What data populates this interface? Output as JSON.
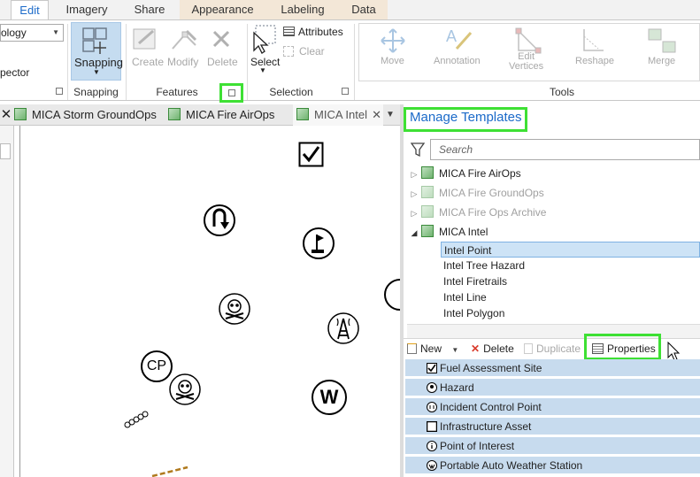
{
  "tabs": [
    {
      "label": "Edit"
    },
    {
      "label": "Imagery"
    },
    {
      "label": "Share"
    },
    {
      "label": "Appearance"
    },
    {
      "label": "Labeling"
    },
    {
      "label": "Data"
    }
  ],
  "ribbon": {
    "combo_value": "ology",
    "inspector_label": "pector",
    "snapping_label": "Snapping",
    "snapping_group": "Snapping",
    "create_label": "Create",
    "modify_label": "Modify",
    "delete_label": "Delete",
    "features_group": "Features",
    "select_label": "Select",
    "attributes_label": "Attributes",
    "clear_label": "Clear",
    "selection_group": "Selection",
    "move_label": "Move",
    "annotation_label": "Annotation",
    "edit_vertices_label": "Edit\nVertices",
    "reshape_label": "Reshape",
    "merge_label": "Merge",
    "tools_group": "Tools"
  },
  "doc_tabs": [
    {
      "label": "MICA Storm GroundOps"
    },
    {
      "label": "MICA Fire AirOps"
    },
    {
      "label": "MICA Intel"
    }
  ],
  "templates": {
    "title": "Manage Templates",
    "search_placeholder": "Search",
    "maps": [
      {
        "label": "MICA Fire AirOps",
        "faded": false
      },
      {
        "label": "MICA Fire GroundOps",
        "faded": true
      },
      {
        "label": "MICA Fire Ops Archive",
        "faded": true
      },
      {
        "label": "MICA Intel",
        "faded": false
      }
    ],
    "layers": [
      "Intel Point",
      "Intel Tree Hazard",
      "Intel Firetrails",
      "Intel Line",
      "Intel Polygon"
    ],
    "toolbar": {
      "new_label": "New",
      "delete_label": "Delete",
      "duplicate_label": "Duplicate",
      "properties_label": "Properties"
    },
    "features": [
      "Fuel Assessment Site",
      "Hazard",
      "Incident Control Point",
      "Infrastructure Asset",
      "Point of Interest",
      "Portable Auto Weather Station"
    ]
  },
  "map_labels": {
    "cp": "CP",
    "w": "W"
  },
  "colors": {
    "accent": "#1b6ac9",
    "highlight": "#3ee034",
    "selected_row": "#cde3f6",
    "feature_row": "#c7dbee"
  }
}
